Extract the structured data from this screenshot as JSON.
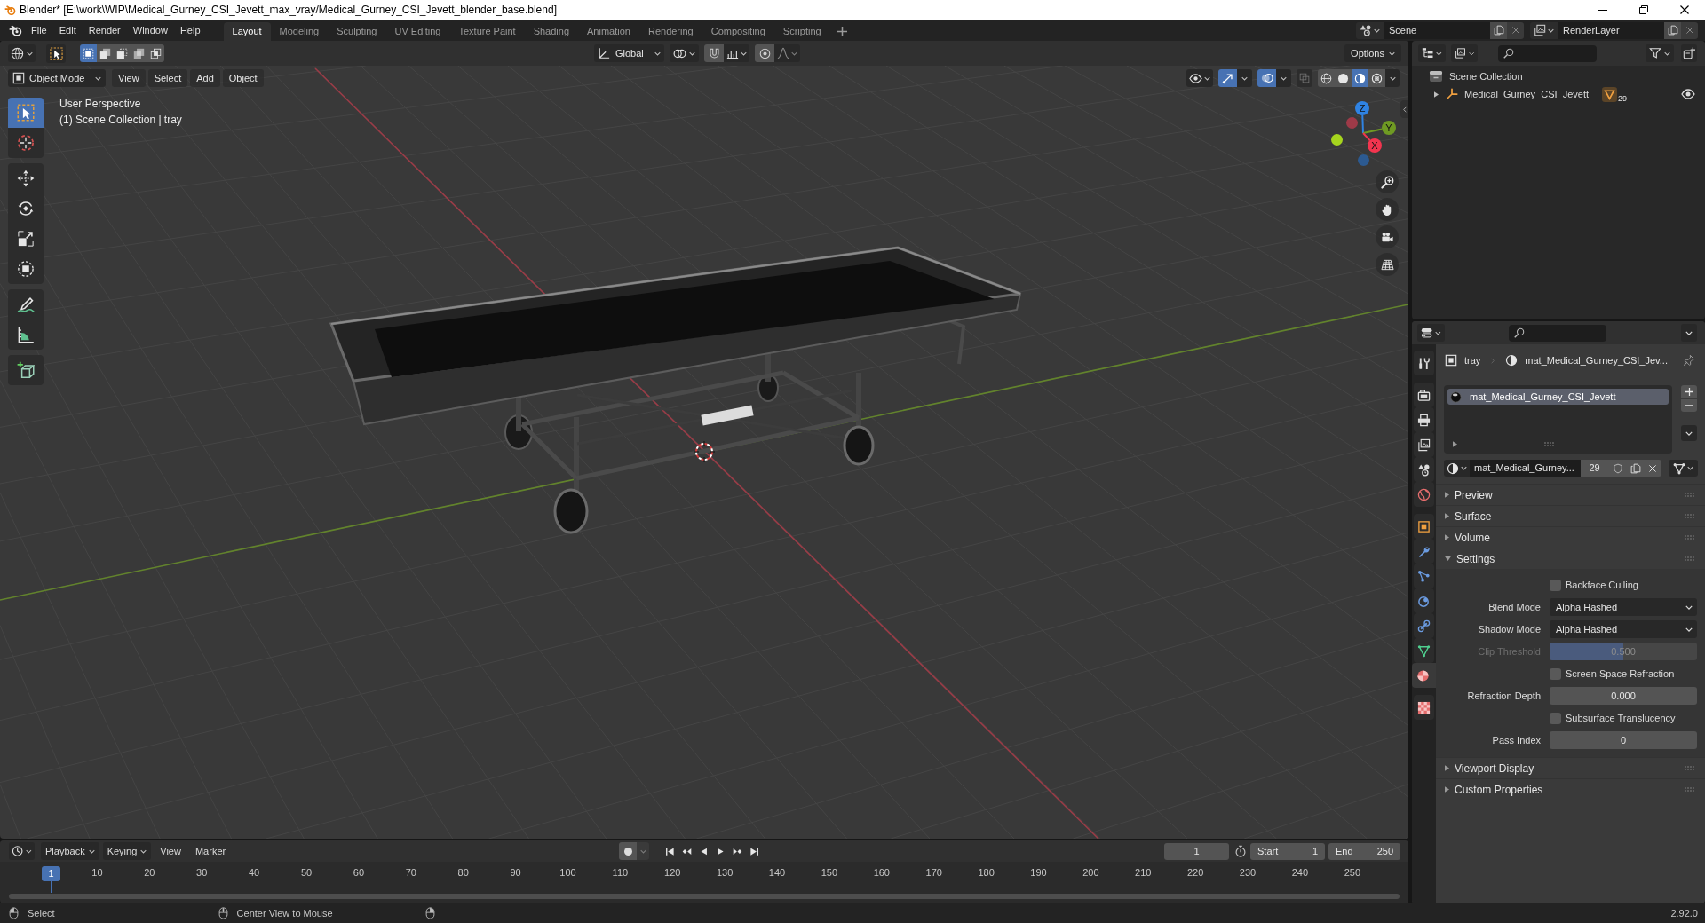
{
  "window": {
    "title": "Blender* [E:\\work\\WIP\\Medical_Gurney_CSI_Jevett_max_vray/Medical_Gurney_CSI_Jevett_blender_base.blend]"
  },
  "menu": [
    "File",
    "Edit",
    "Render",
    "Window",
    "Help"
  ],
  "workspaces": [
    {
      "label": "Layout",
      "selected": true
    },
    {
      "label": "Modeling",
      "selected": false
    },
    {
      "label": "Sculpting",
      "selected": false
    },
    {
      "label": "UV Editing",
      "selected": false
    },
    {
      "label": "Texture Paint",
      "selected": false
    },
    {
      "label": "Shading",
      "selected": false
    },
    {
      "label": "Animation",
      "selected": false
    },
    {
      "label": "Rendering",
      "selected": false
    },
    {
      "label": "Compositing",
      "selected": false
    },
    {
      "label": "Scripting",
      "selected": false
    }
  ],
  "scene": {
    "name": "Scene"
  },
  "view_layer": {
    "name": "RenderLayer"
  },
  "tool_header": {
    "select_modes": [
      {
        "kind": "set",
        "selected": true
      },
      {
        "kind": "extend",
        "selected": false
      },
      {
        "kind": "subtract",
        "selected": false
      },
      {
        "kind": "difference",
        "selected": false
      },
      {
        "kind": "intersect",
        "selected": false
      }
    ],
    "orientation": "Global",
    "options": "Options"
  },
  "viewport_header": {
    "mode": "Object Mode",
    "menus": [
      "View",
      "Select",
      "Add",
      "Object"
    ],
    "gizmos": true,
    "overlays": true,
    "xray": false,
    "shading": [
      {
        "kind": "wireframe",
        "selected": false
      },
      {
        "kind": "solid",
        "selected": false
      },
      {
        "kind": "material",
        "selected": true
      },
      {
        "kind": "rendered",
        "selected": false
      }
    ]
  },
  "toolbar": [
    [
      {
        "kind": "select-box",
        "selected": true
      },
      {
        "kind": "cursor",
        "selected": false
      }
    ],
    [
      {
        "kind": "move",
        "selected": false
      },
      {
        "kind": "rotate",
        "selected": false
      },
      {
        "kind": "scale",
        "selected": false
      },
      {
        "kind": "transform",
        "selected": false
      }
    ],
    [
      {
        "kind": "annotate",
        "selected": false
      },
      {
        "kind": "measure",
        "selected": false
      }
    ],
    [
      {
        "kind": "add-cube",
        "selected": false
      }
    ]
  ],
  "viewport": {
    "view_name": "User Perspective",
    "context": "(1) Scene Collection | tray",
    "axes": [
      {
        "label": "Z",
        "color": "#2f83e3"
      },
      {
        "label": "Y",
        "color": "#6f9a23"
      },
      {
        "label": "X",
        "color": "#f3354f"
      }
    ]
  },
  "outliner": {
    "root": "Scene Collection",
    "items": [
      {
        "name": "Medical_Gurney_CSI_Jevett",
        "expanded": false,
        "badge": "29",
        "visible": true
      }
    ]
  },
  "properties": {
    "tabs": [
      [
        {
          "kind": "tool",
          "selected": false
        }
      ],
      [
        {
          "kind": "render",
          "selected": false
        },
        {
          "kind": "output",
          "selected": false
        },
        {
          "kind": "view-layer",
          "selected": false
        },
        {
          "kind": "scene",
          "selected": false
        },
        {
          "kind": "world",
          "selected": false
        }
      ],
      [
        {
          "kind": "object",
          "selected": false
        },
        {
          "kind": "modifiers",
          "selected": false
        },
        {
          "kind": "particles",
          "selected": false
        },
        {
          "kind": "physics",
          "selected": false
        },
        {
          "kind": "constraints",
          "selected": false
        },
        {
          "kind": "data",
          "selected": false
        },
        {
          "kind": "material",
          "selected": true
        }
      ],
      [
        {
          "kind": "texture",
          "selected": false
        }
      ]
    ],
    "breadcrumb": [
      {
        "kind": "object",
        "label": "tray"
      },
      {
        "kind": "material",
        "label": "mat_Medical_Gurney_CSI_Jev..."
      }
    ],
    "material_slots": [
      {
        "name": "mat_Medical_Gurney_CSI_Jevett",
        "selected": true
      }
    ],
    "material": {
      "name": "mat_Medical_Gurney...",
      "users": "29"
    },
    "panels": [
      {
        "title": "Preview",
        "expanded": false
      },
      {
        "title": "Surface",
        "expanded": false
      },
      {
        "title": "Volume",
        "expanded": false
      },
      {
        "title": "Settings",
        "expanded": true,
        "fields": [
          {
            "kind": "checkbox",
            "label": "Backface Culling",
            "checked": false,
            "disabled": false
          },
          {
            "kind": "dropdown",
            "label": "Blend Mode",
            "value": "Alpha Hashed",
            "disabled": false
          },
          {
            "kind": "dropdown",
            "label": "Shadow Mode",
            "value": "Alpha Hashed",
            "disabled": false
          },
          {
            "kind": "slider",
            "label": "Clip Threshold",
            "value": "0.500",
            "level": 0.5,
            "disabled": true
          },
          {
            "kind": "checkbox",
            "label": "Screen Space Refraction",
            "checked": false,
            "disabled": false
          },
          {
            "kind": "number",
            "label": "Refraction Depth",
            "value": "0.000",
            "disabled": false
          },
          {
            "kind": "checkbox",
            "label": "Subsurface Translucency",
            "checked": false,
            "disabled": false
          },
          {
            "kind": "number",
            "label": "Pass Index",
            "value": "0",
            "disabled": false
          }
        ]
      },
      {
        "title": "Viewport Display",
        "expanded": false
      },
      {
        "title": "Custom Properties",
        "expanded": false
      }
    ]
  },
  "timeline": {
    "menus": [
      {
        "kind": "dropdown",
        "label": "Playback"
      },
      {
        "kind": "dropdown",
        "label": "Keying"
      },
      {
        "kind": "menu",
        "label": "View"
      },
      {
        "kind": "menu",
        "label": "Marker"
      }
    ],
    "current_frame": "1",
    "start": {
      "label": "Start",
      "value": "1"
    },
    "end": {
      "label": "End",
      "value": "250"
    },
    "playhead": "1",
    "ruler": [
      "10",
      "20",
      "30",
      "40",
      "50",
      "60",
      "70",
      "80",
      "90",
      "100",
      "110",
      "120",
      "130",
      "140",
      "150",
      "160",
      "170",
      "180",
      "190",
      "200",
      "210",
      "220",
      "230",
      "240",
      "250"
    ]
  },
  "status_bar": {
    "hints": [
      {
        "kind": "left",
        "label": "Select"
      },
      {
        "kind": "middle",
        "label": "Center View to Mouse"
      },
      {
        "kind": "right"
      }
    ],
    "version": "2.92.0"
  }
}
